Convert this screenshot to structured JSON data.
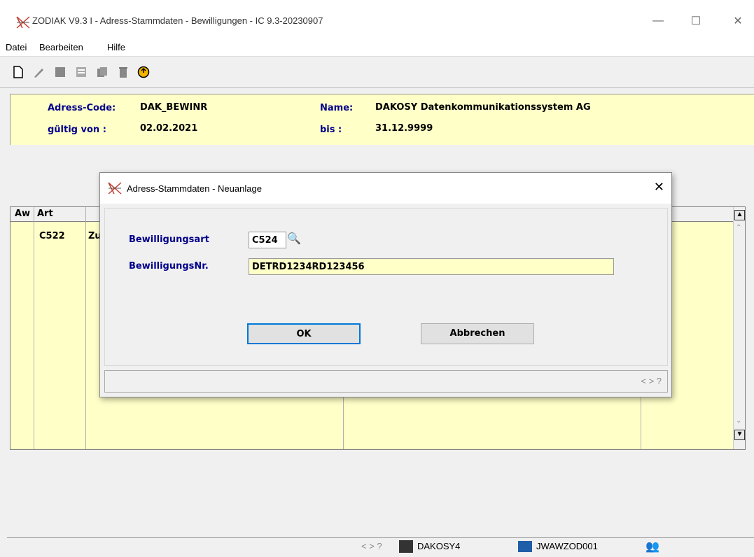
{
  "window": {
    "title": "ZODIAK V9.3 I - Adress-Stammdaten - Bewilligungen - IC 9.3-20230907",
    "min_glyph": "—",
    "max_glyph": "☐",
    "close_glyph": "✕"
  },
  "menu": {
    "datei": "Datei",
    "bearbeiten": "Bearbeiten",
    "hilfe": "Hilfe"
  },
  "toolbar": {
    "icons": [
      "new-document-icon",
      "edit-pencil-icon",
      "save-icon",
      "form-icon",
      "copy-icon",
      "delete-icon",
      "exit-icon"
    ]
  },
  "header": {
    "address_code_label": "Adress-Code:",
    "address_code": "DAK_BEWINR",
    "name_label": "Name:",
    "name": "DAKOSY Datenkommunikationssystem AG",
    "valid_from_label": "gültig von :",
    "valid_from": "02.02.2021",
    "valid_to_label": "bis :",
    "valid_to": "31.12.9999"
  },
  "grid": {
    "columns": [
      "Aw",
      "Art"
    ],
    "rows": [
      {
        "art": "C522",
        "text": "Zu"
      }
    ]
  },
  "dialog": {
    "title": "Adress-Stammdaten - Neuanlage",
    "close_glyph": "✕",
    "type_label": "Bewilligungsart",
    "type_value": "C524",
    "number_label": "BewilligungsNr.",
    "number_value": "DETRD1234RD123456",
    "ok_label": "OK",
    "cancel_label": "Abbrechen",
    "nav": "<  >  ?"
  },
  "status": {
    "nav": "<  >  ?",
    "user": "DAKOSY4",
    "host": "JWAWZOD001"
  }
}
